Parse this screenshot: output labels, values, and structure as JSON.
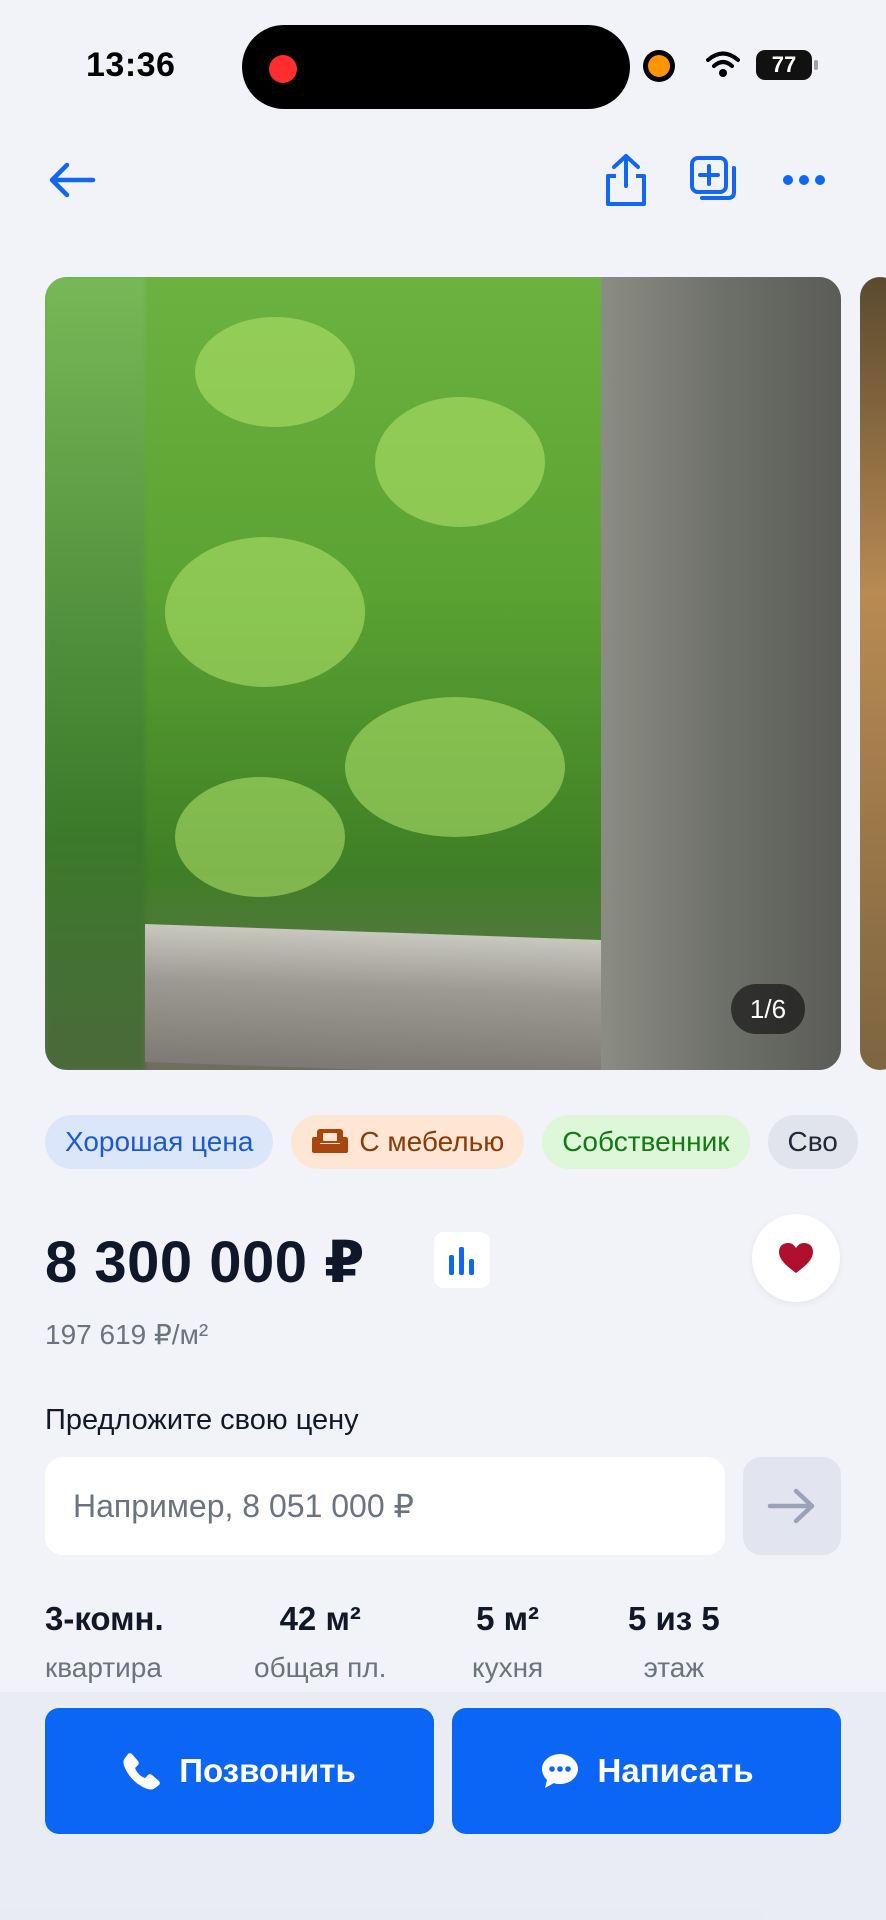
{
  "status_bar": {
    "time": "13:36",
    "battery": "77"
  },
  "gallery": {
    "counter": "1/6"
  },
  "chips": [
    {
      "label": "Хорошая цена"
    },
    {
      "label": "С мебелью"
    },
    {
      "label": "Собственник"
    },
    {
      "label": "Сво"
    }
  ],
  "price": {
    "value": "8 300 000 ₽",
    "per_sqm": "197 619 ₽/м²"
  },
  "offer": {
    "label": "Предложите свою цену",
    "placeholder": "Например, 8 051 000 ₽"
  },
  "features": [
    {
      "value": "3-комн.",
      "label": "квартира"
    },
    {
      "value": "42 м²",
      "label": "общая пл."
    },
    {
      "value": "5 м²",
      "label": "кухня"
    },
    {
      "value": "5 из 5",
      "label": "этаж"
    }
  ],
  "actions": {
    "call_label": "Позвонить",
    "write_label": "Написать"
  },
  "colors": {
    "accent": "#0b66f5",
    "favorite": "#b0102e"
  }
}
